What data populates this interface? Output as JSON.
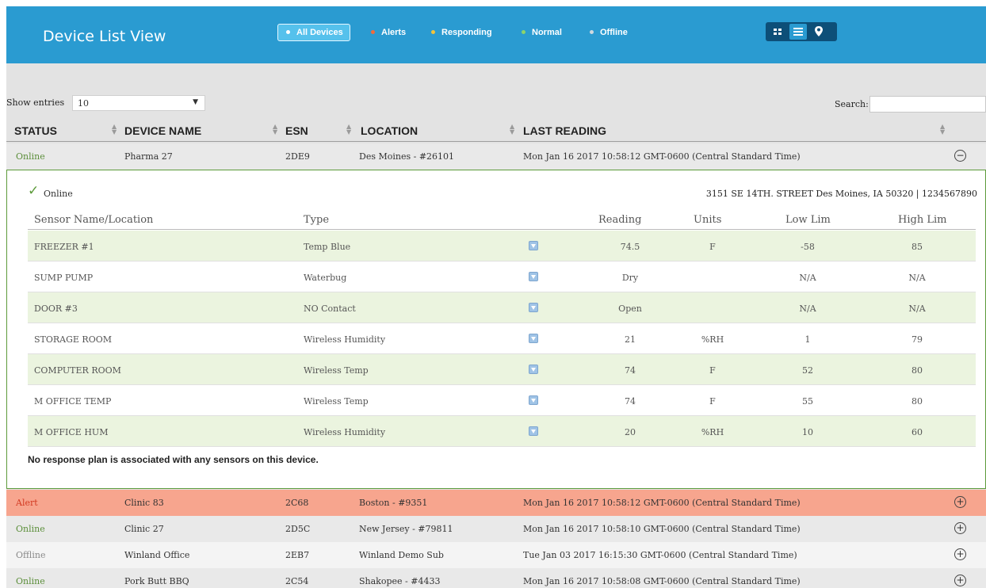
{
  "header": {
    "title": "Device List View",
    "filters": [
      {
        "label": "All Devices",
        "dot_color": "#ffffff"
      },
      {
        "label": "Alerts",
        "dot_color": "#f26b3a"
      },
      {
        "label": "Responding",
        "dot_color": "#f3c33b"
      },
      {
        "label": "Normal",
        "dot_color": "#8dd36b"
      },
      {
        "label": "Offline",
        "dot_color": "#cfd9e0"
      }
    ],
    "active_filter": "All Devices",
    "view_modes": [
      "grid-icon",
      "list-icon",
      "map-pin-icon"
    ],
    "active_view": "list-icon"
  },
  "controls": {
    "show_entries_label": "Show entries",
    "entries_value": "10",
    "search_label": "Search:"
  },
  "table": {
    "columns": [
      "STATUS",
      "DEVICE NAME",
      "ESN",
      "LOCATION",
      "LAST READING"
    ],
    "rows": [
      {
        "status": "Online",
        "name": "Pharma 27",
        "esn": "2DE9",
        "location": "Des Moines - #26101",
        "last_reading": "Mon Jan 16 2017 10:58:12 GMT-0600 (Central Standard Time)",
        "expanded": true
      },
      {
        "status": "Alert",
        "name": "Clinic 83",
        "esn": "2C68",
        "location": "Boston - #9351",
        "last_reading": "Mon Jan 16 2017 10:58:12 GMT-0600 (Central Standard Time)",
        "expanded": false
      },
      {
        "status": "Online",
        "name": "Clinic 27",
        "esn": "2D5C",
        "location": "New Jersey - #79811",
        "last_reading": "Mon Jan 16 2017 10:58:10 GMT-0600 (Central Standard Time)",
        "expanded": false
      },
      {
        "status": "Offline",
        "name": "Winland Office",
        "esn": "2EB7",
        "location": "Winland Demo Sub",
        "last_reading": "Tue Jan 03 2017 16:15:30 GMT-0600 (Central Standard Time)",
        "expanded": false
      },
      {
        "status": "Online",
        "name": "Pork Butt BBQ",
        "esn": "2C54",
        "location": "Shakopee - #4433",
        "last_reading": "Mon Jan 16 2017 10:58:08 GMT-0600 (Central Standard Time)",
        "expanded": false
      }
    ]
  },
  "detail": {
    "status": "Online",
    "address": "3151 SE 14TH. STREET Des Moines, IA 50320 | 1234567890",
    "columns": [
      "Sensor Name/Location",
      "Type",
      "Reading",
      "Units",
      "Low Lim",
      "High Lim"
    ],
    "sensors": [
      {
        "name": "FREEZER #1",
        "type": "Temp Blue",
        "reading": "74.5",
        "units": "F",
        "low": "-58",
        "high": "85"
      },
      {
        "name": "SUMP PUMP",
        "type": "Waterbug",
        "reading": "Dry",
        "units": "",
        "low": "N/A",
        "high": "N/A"
      },
      {
        "name": "DOOR #3",
        "type": "NO Contact",
        "reading": "Open",
        "units": "",
        "low": "N/A",
        "high": "N/A"
      },
      {
        "name": "STORAGE ROOM",
        "type": "Wireless Humidity",
        "reading": "21",
        "units": "%RH",
        "low": "1",
        "high": "79"
      },
      {
        "name": "COMPUTER ROOM",
        "type": "Wireless Temp",
        "reading": "74",
        "units": "F",
        "low": "52",
        "high": "80"
      },
      {
        "name": "M OFFICE TEMP",
        "type": "Wireless Temp",
        "reading": "74",
        "units": "F",
        "low": "55",
        "high": "80"
      },
      {
        "name": "M OFFICE HUM",
        "type": "Wireless Humidity",
        "reading": "20",
        "units": "%RH",
        "low": "10",
        "high": "60"
      }
    ],
    "note": "No response plan is associated with any sensors on this device."
  },
  "colors": {
    "header_bg": "#2a9bd1",
    "alert_row_bg": "#f7a58e",
    "expanded_border": "#5c9a3a",
    "sensor_row_shade": "#ebf4df"
  }
}
